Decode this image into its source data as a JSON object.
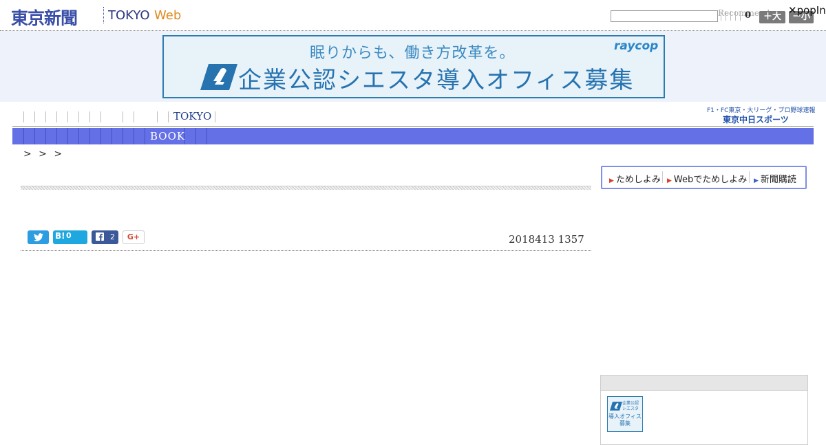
{
  "header": {
    "logo_kanji": "東京新聞",
    "logo_tokyo": "TOKYO",
    "logo_web": "Web",
    "search_placeholder": "",
    "recommend_text": "Recommend",
    "count": "0",
    "font_large_label": "＋大",
    "font_small_label": "－小",
    "popin_close": "✕",
    "popin_label": "popIn"
  },
  "banner": {
    "line1": "眠りからも、働き方改革を。",
    "line2": "企業公認シエスタ導入オフィス募集",
    "brand": "raycop"
  },
  "nav_primary": {
    "tokyo_label": "TOKYO",
    "chunichi_line1": "F1・FC東京・大リーグ・プロ野球速報",
    "chunichi_line2": "東京中日スポーツ"
  },
  "nav_secondary": {
    "book_label": "BOOK"
  },
  "breadcrumb": "> > >",
  "article": {
    "date": "2018413 1357"
  },
  "share": {
    "twitter_icon": "twitter-icon",
    "hatena_label": "B!",
    "hatena_count": "0",
    "facebook_label": "f",
    "facebook_count": "2",
    "gplus_label": "G+"
  },
  "sidebar": {
    "link_tameshi": "ためしよみ",
    "link_web_tameshi": "Webでためしよみ",
    "link_shinbun": "新聞購読",
    "thumb_line1": "企業公認\nシエスタ",
    "thumb_line2": "導入オフィス\n募集"
  },
  "colors": {
    "nav_bar": "#6470e6",
    "logo_blue": "#3a4fa8",
    "web_orange": "#e08a1e",
    "banner_blue": "#2673b0"
  }
}
